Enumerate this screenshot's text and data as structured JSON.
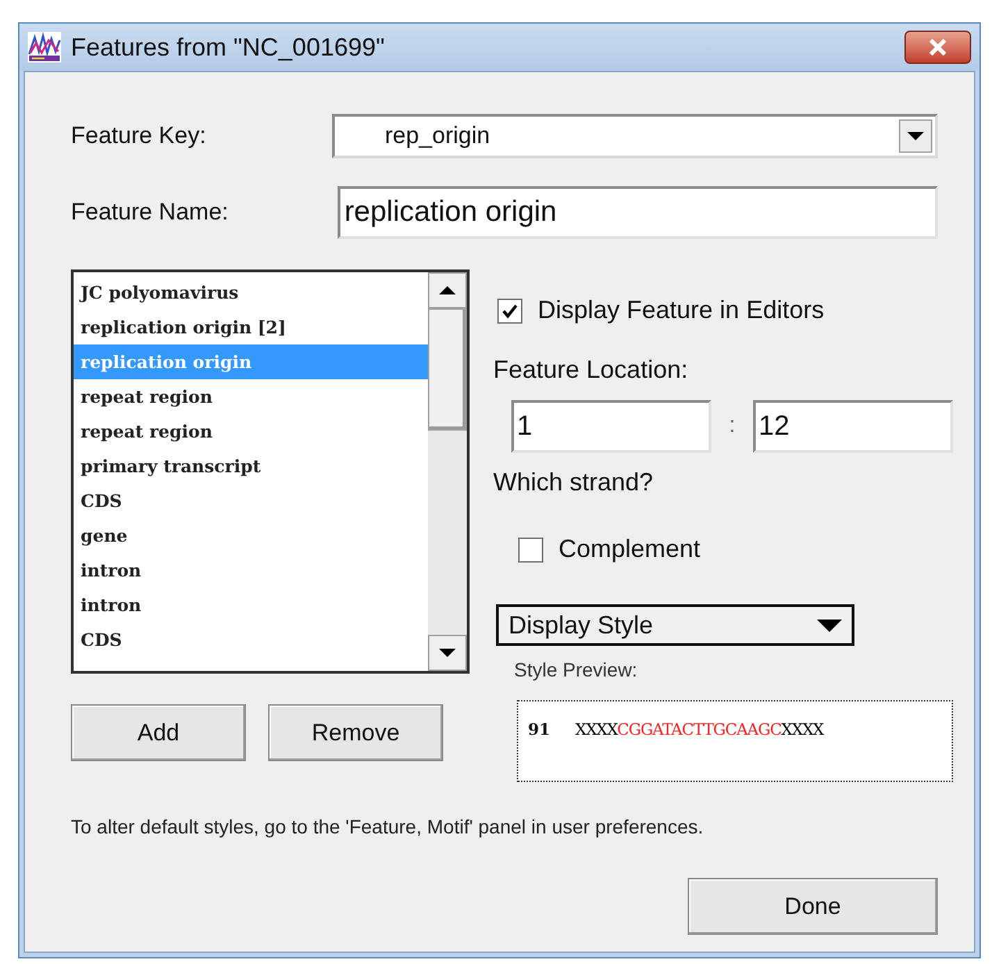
{
  "window": {
    "title": "Features from \"NC_001699\""
  },
  "feature_key": {
    "label": "Feature Key:",
    "value": "rep_origin"
  },
  "feature_name": {
    "label": "Feature Name:",
    "value": "replication origin"
  },
  "feature_list": {
    "items": [
      {
        "label": "JC polyomavirus",
        "selected": false
      },
      {
        "label": "replication origin [2]",
        "selected": false
      },
      {
        "label": "replication origin",
        "selected": true
      },
      {
        "label": "repeat region",
        "selected": false
      },
      {
        "label": "repeat region",
        "selected": false
      },
      {
        "label": "primary transcript",
        "selected": false
      },
      {
        "label": "CDS",
        "selected": false
      },
      {
        "label": "gene",
        "selected": false
      },
      {
        "label": "intron",
        "selected": false
      },
      {
        "label": "intron",
        "selected": false
      },
      {
        "label": "CDS",
        "selected": false
      }
    ]
  },
  "display_in_editors": {
    "label": "Display Feature in Editors",
    "checked": true
  },
  "location": {
    "label": "Feature Location:",
    "start": "1",
    "separator": ":",
    "end": "12"
  },
  "strand": {
    "label": "Which strand?",
    "complement": {
      "label": "Complement",
      "checked": false
    }
  },
  "display_style": {
    "label": "Display Style"
  },
  "style_preview": {
    "label": "Style Preview:",
    "line_number": "91",
    "segments": [
      {
        "text": "XXXX",
        "color": "#000000"
      },
      {
        "text": "CGGATACTTGCAAGC",
        "color": "#ff2020"
      },
      {
        "text": "XXXX",
        "color": "#000000"
      }
    ]
  },
  "buttons": {
    "add": "Add",
    "remove": "Remove",
    "done": "Done"
  },
  "note": "To alter default styles, go to the 'Feature, Motif' panel in user preferences."
}
